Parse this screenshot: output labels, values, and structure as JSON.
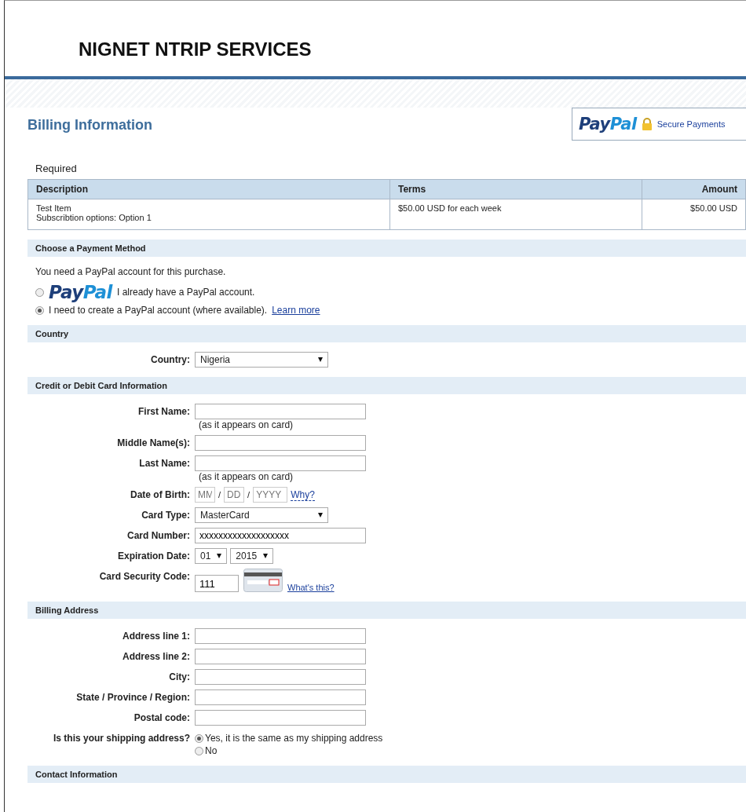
{
  "header": {
    "title": "NIGNET NTRIP SERVICES"
  },
  "page_title": "Billing Information",
  "badge": {
    "logo": "PayPal",
    "text": "Secure Payments"
  },
  "required_note": "Required",
  "order_table": {
    "columns": [
      "Description",
      "Terms",
      "Amount"
    ],
    "rows": [
      {
        "description": [
          "Test Item",
          "Subscribtion options: Option 1"
        ],
        "terms": "$50.00 USD for each week",
        "amount": "$50.00 USD"
      }
    ]
  },
  "sections": [
    {
      "kind": "payment",
      "title": "Choose a Payment Method",
      "note": "You need a PayPal account for this purchase.",
      "options": [
        {
          "logo": "PayPal",
          "label": "I already have a PayPal account.",
          "selected": false
        },
        {
          "label": "I need to create a PayPal account (where available).",
          "link": "Learn more",
          "selected": true
        }
      ]
    },
    {
      "kind": "form",
      "title": "Country",
      "fields": [
        {
          "kind": "select",
          "label": "Country:",
          "value": "Nigeria"
        }
      ]
    },
    {
      "kind": "form",
      "title": "Credit or Debit Card Information",
      "fields": [
        {
          "kind": "text",
          "label": "First Name:",
          "hint": "(as it appears on card)"
        },
        {
          "kind": "text",
          "label": "Middle Name(s):"
        },
        {
          "kind": "text",
          "label": "Last Name:",
          "hint": "(as it appears on card)"
        },
        {
          "kind": "date",
          "label": "Date of Birth:",
          "parts": [
            {
              "placeholder": "MM",
              "separator": "/"
            },
            {
              "placeholder": "DD",
              "separator": "/"
            },
            {
              "placeholder": "YYYY"
            }
          ],
          "link": "Why?"
        },
        {
          "kind": "select",
          "label": "Card Type:",
          "value": "MasterCard"
        },
        {
          "kind": "text",
          "label": "Card Number:",
          "value": "xxxxxxxxxxxxxxxxxxx"
        },
        {
          "kind": "selects",
          "label": "Expiration Date:",
          "values": [
            "01",
            "2015"
          ]
        },
        {
          "kind": "cvv",
          "label": "Card Security Code:",
          "value": "111",
          "link": "What's this?"
        }
      ]
    },
    {
      "kind": "form",
      "title": "Billing Address",
      "fields": [
        {
          "kind": "text",
          "label": "Address line 1:"
        },
        {
          "kind": "text",
          "label": "Address line 2:"
        },
        {
          "kind": "text",
          "label": "City:"
        },
        {
          "kind": "text",
          "label": "State / Province / Region:"
        },
        {
          "kind": "text",
          "label": "Postal code:"
        },
        {
          "kind": "radio",
          "label": "Is this your shipping address?",
          "options": [
            {
              "label": "Yes, it is the same as my shipping address",
              "selected": true
            },
            {
              "label": "No",
              "selected": false
            }
          ]
        }
      ]
    },
    {
      "kind": "form",
      "title": "Contact Information"
    }
  ]
}
